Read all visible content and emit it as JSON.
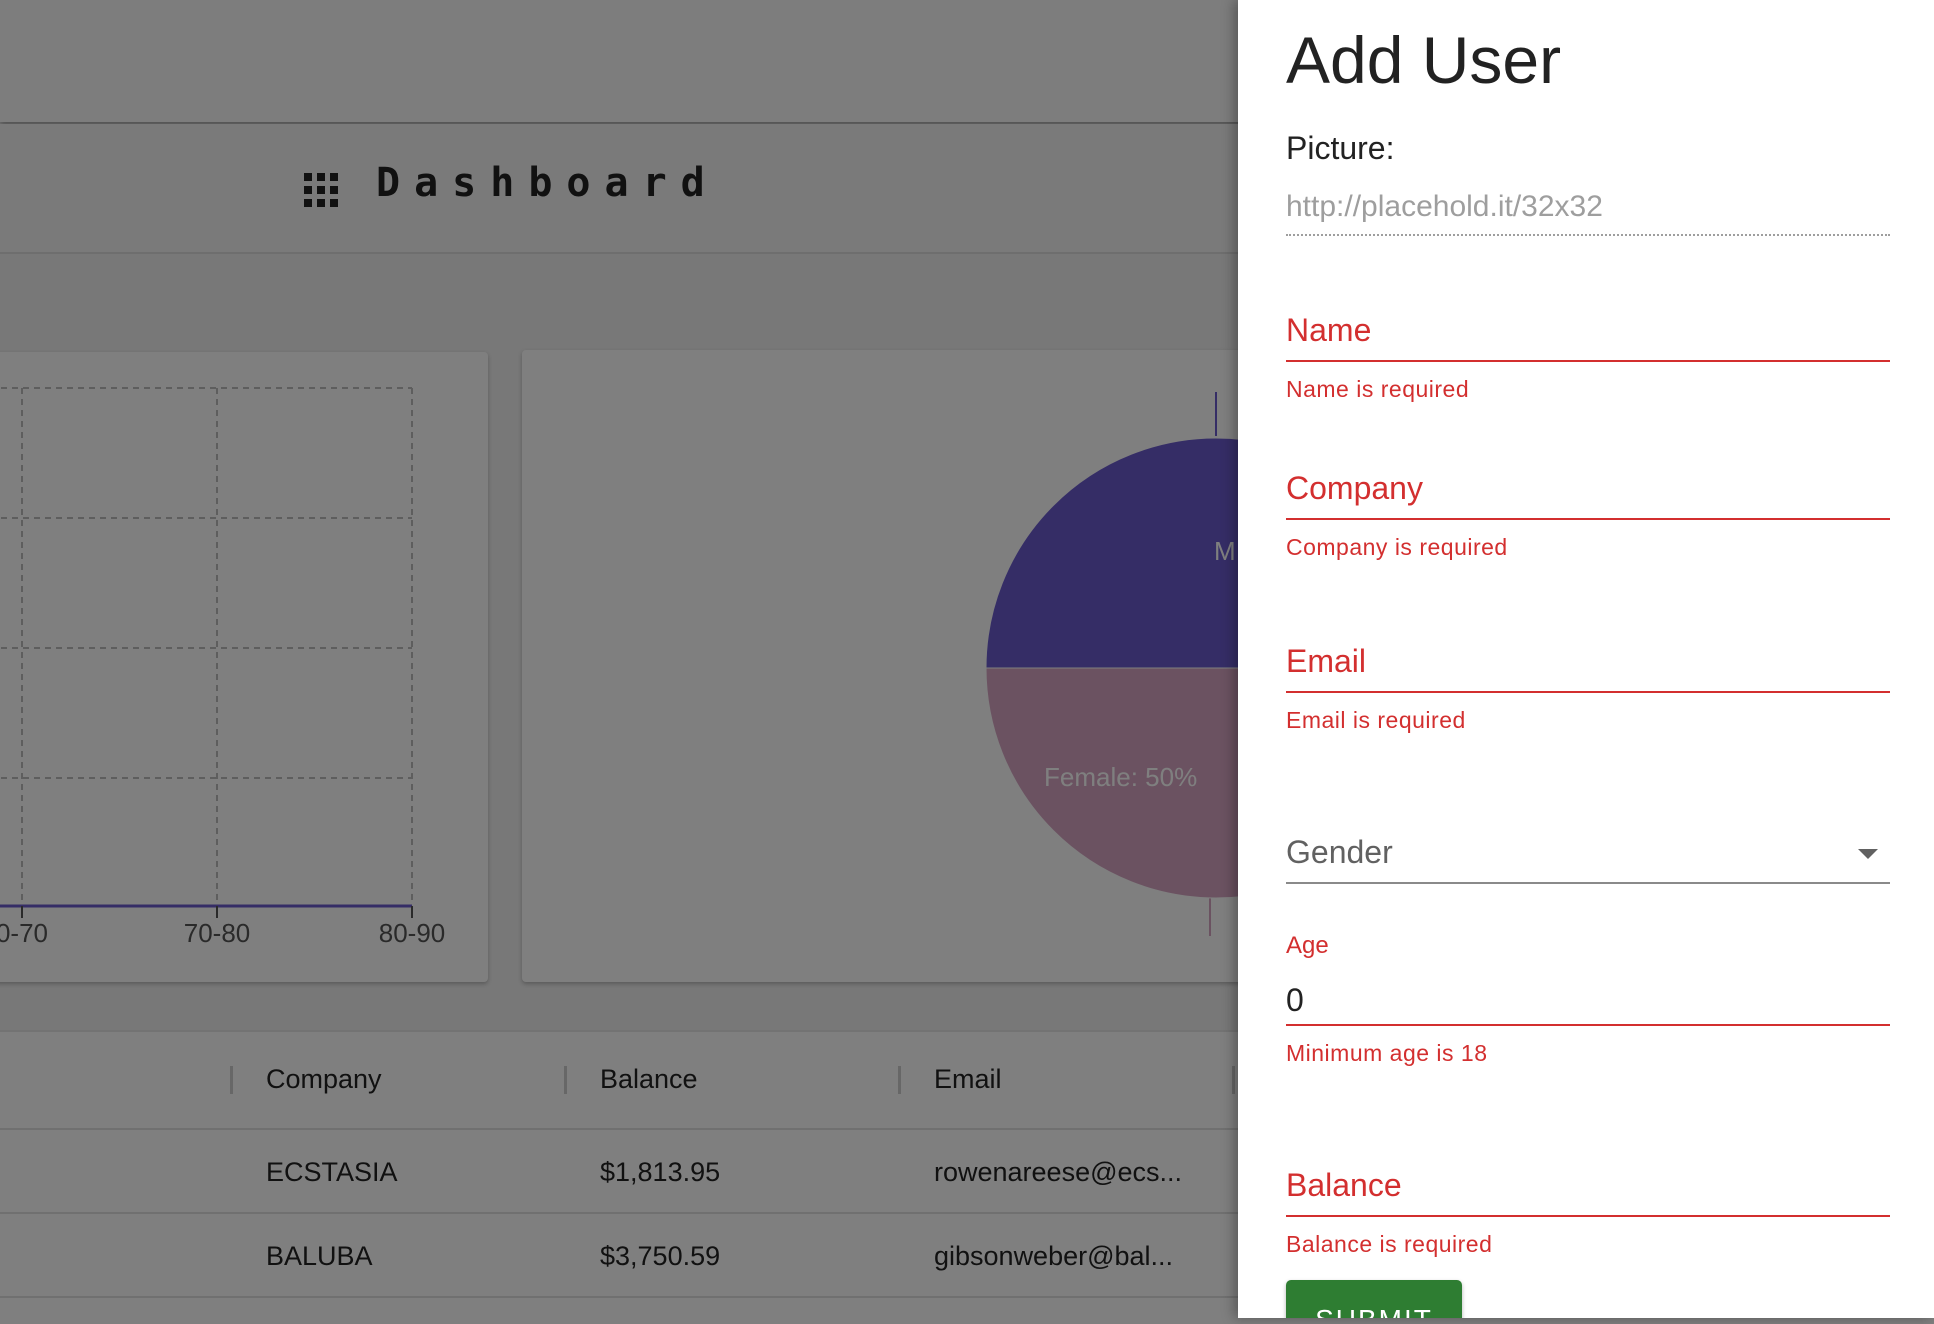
{
  "dashboard": {
    "title": "Dashboard",
    "icon": "apps-grid-icon"
  },
  "bar_chart": {
    "x_ticks": [
      "0-70",
      "70-80",
      "80-90"
    ]
  },
  "chart_data": {
    "type": "pie",
    "slices": [
      {
        "label": "M",
        "value": 50,
        "color": "#6a5acd"
      },
      {
        "label": "Female: 50%",
        "value": 50,
        "color": "#d6a5c3"
      }
    ]
  },
  "table": {
    "headers": [
      "Company",
      "Balance",
      "Email"
    ],
    "rows": [
      {
        "company": "ECSTASIA",
        "balance": "$1,813.95",
        "email": "rowenareese@ecs..."
      },
      {
        "company": "BALUBA",
        "balance": "$3,750.59",
        "email": "gibsonweber@bal..."
      }
    ]
  },
  "drawer": {
    "title": "Add User",
    "picture_label": "Picture:",
    "picture_placeholder": "http://placehold.it/32x32",
    "fields": {
      "name": {
        "label": "Name",
        "error": "Name is required"
      },
      "company": {
        "label": "Company",
        "error": "Company is required"
      },
      "email": {
        "label": "Email",
        "error": "Email is required"
      },
      "gender": {
        "label": "Gender"
      },
      "age": {
        "label": "Age",
        "value": "0",
        "error": "Minimum age is 18"
      },
      "balance": {
        "label": "Balance",
        "error": "Balance is required"
      }
    },
    "submit_label": "SUBMIT"
  },
  "colors": {
    "error": "#d32f2f",
    "submit": "#2e7d32"
  }
}
